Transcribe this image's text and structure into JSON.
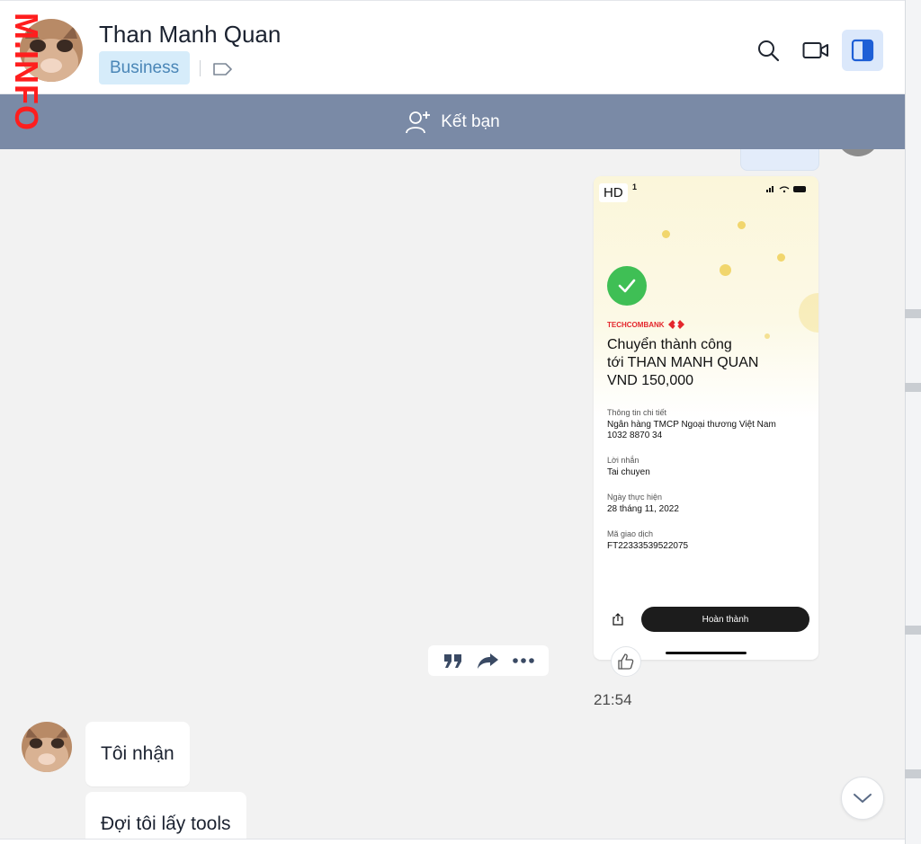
{
  "watermark": "M.INFO",
  "header": {
    "contact_name": "Than Manh Quan",
    "badge": "Business",
    "icons": [
      "search-icon",
      "video-call-icon",
      "sidebar-toggle-icon",
      "tag-icon"
    ]
  },
  "friend_bar": {
    "label": "Kết bạn",
    "icon": "add-friend-icon"
  },
  "transfer_receipt": {
    "hd_label": "HD",
    "status_digit": "1",
    "bank_name": "TECHCOMBANK",
    "title_line1": "Chuyển thành công",
    "title_line2": "tới THAN MANH QUAN",
    "amount": "VND 150,000",
    "details_label": "Thông tin chi tiết",
    "bank_full_name": "Ngân hàng TMCP Ngoại thương Việt Nam",
    "account_number": "1032 8870 34",
    "message_label": "Lời nhắn",
    "message_value": "Tai chuyen",
    "date_label": "Ngày thực hiện",
    "date_value": "28 tháng 11, 2022",
    "txn_label": "Mã giao dịch",
    "txn_value": "FT22333539522075",
    "done_button": "Hoàn thành"
  },
  "message_actions": [
    "quote-icon",
    "forward-icon",
    "more-icon"
  ],
  "message_time": "21:54",
  "incoming_messages": [
    {
      "text": "Tôi nhận"
    },
    {
      "text": "Đợi tôi lấy tools"
    }
  ],
  "colors": {
    "friend_bar": "#7a8aa6",
    "badge_bg": "#d6ecfa",
    "badge_text": "#4a86b7",
    "chat_bg": "#f2f2f2",
    "success_green": "#3fbf55",
    "techcombank_red": "#e4262c",
    "watermark_red": "#ff1e1e"
  }
}
